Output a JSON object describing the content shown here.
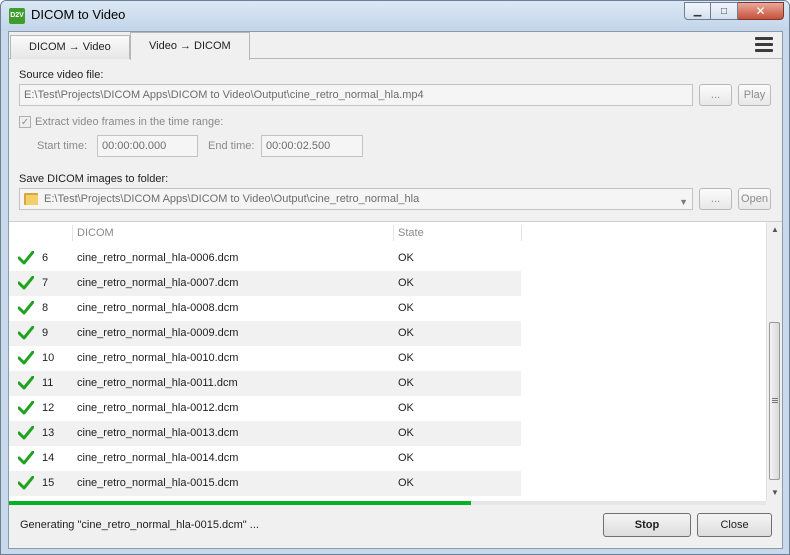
{
  "window": {
    "title": "DICOM to Video",
    "app_icon_text": "D2V"
  },
  "tabs": [
    {
      "label": "DICOM → Video",
      "active": false
    },
    {
      "label": "Video → DICOM",
      "active": true
    }
  ],
  "source": {
    "label": "Source video file:",
    "path": "E:\\Test\\Projects\\DICOM Apps\\DICOM to Video\\Output\\cine_retro_normal_hla.mp4",
    "browse_label": "...",
    "play_label": "Play"
  },
  "time_range": {
    "checkbox_label": "Extract video frames in the time range:",
    "checked": true,
    "start_label": "Start time:",
    "start_value": "00:00:00.000",
    "end_label": "End time:",
    "end_value": "00:00:02.500"
  },
  "save": {
    "label": "Save DICOM images to folder:",
    "path": "E:\\Test\\Projects\\DICOM Apps\\DICOM to Video\\Output\\cine_retro_normal_hla",
    "browse_label": "...",
    "open_label": "Open"
  },
  "table": {
    "columns": [
      "DICOM",
      "State"
    ],
    "rows": [
      {
        "num": "6",
        "file": "cine_retro_normal_hla-0006.dcm",
        "state": "OK"
      },
      {
        "num": "7",
        "file": "cine_retro_normal_hla-0007.dcm",
        "state": "OK"
      },
      {
        "num": "8",
        "file": "cine_retro_normal_hla-0008.dcm",
        "state": "OK"
      },
      {
        "num": "9",
        "file": "cine_retro_normal_hla-0009.dcm",
        "state": "OK"
      },
      {
        "num": "10",
        "file": "cine_retro_normal_hla-0010.dcm",
        "state": "OK"
      },
      {
        "num": "11",
        "file": "cine_retro_normal_hla-0011.dcm",
        "state": "OK"
      },
      {
        "num": "12",
        "file": "cine_retro_normal_hla-0012.dcm",
        "state": "OK"
      },
      {
        "num": "13",
        "file": "cine_retro_normal_hla-0013.dcm",
        "state": "OK"
      },
      {
        "num": "14",
        "file": "cine_retro_normal_hla-0014.dcm",
        "state": "OK"
      },
      {
        "num": "15",
        "file": "cine_retro_normal_hla-0015.dcm",
        "state": "OK"
      }
    ]
  },
  "progress": {
    "fraction": 0.61,
    "color": "#06b025"
  },
  "status_text": "Generating \"cine_retro_normal_hla-0015.dcm\" ...",
  "buttons": {
    "stop": "Stop",
    "close": "Close"
  },
  "icons": {
    "row_state": "checkmark-icon",
    "menu": "hamburger-menu-icon",
    "folder": "folder-icon"
  }
}
